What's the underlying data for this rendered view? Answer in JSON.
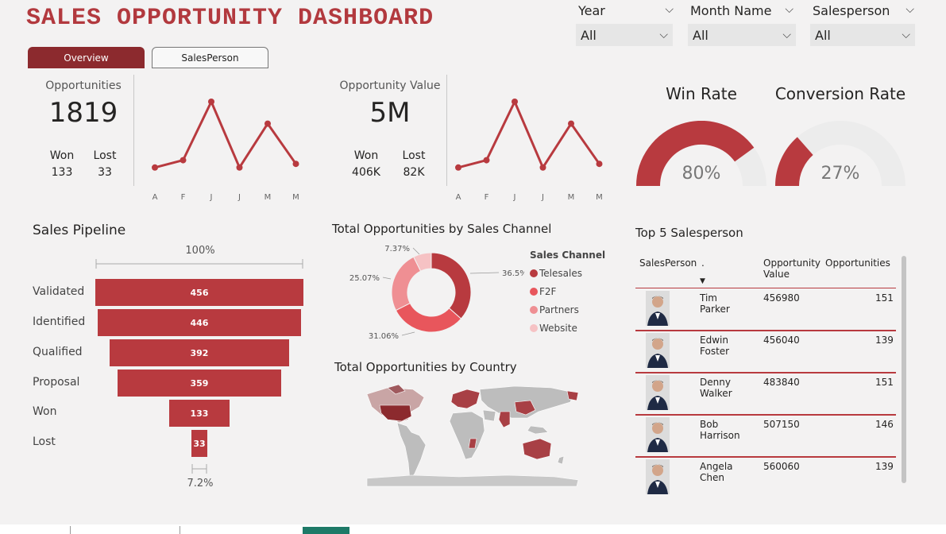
{
  "header": {
    "title": "SALES OPPORTUNITY DASHBOARD"
  },
  "filters": [
    {
      "label": "Year",
      "value": "All"
    },
    {
      "label": "Month Name",
      "value": "All"
    },
    {
      "label": "Salesperson",
      "value": "All"
    }
  ],
  "tabs": [
    {
      "label": "Overview",
      "active": true
    },
    {
      "label": "SalesPerson",
      "active": false
    }
  ],
  "kpis": {
    "opportunities": {
      "label": "Opportunities",
      "value": "1819",
      "won_label": "Won",
      "won_value": "133",
      "lost_label": "Lost",
      "lost_value": "33"
    },
    "opportunity_value": {
      "label": "Opportunity Value",
      "value": "5M",
      "won_label": "Won",
      "won_value": "406K",
      "lost_label": "Lost",
      "lost_value": "82K"
    }
  },
  "gauges": [
    {
      "title": "Win Rate",
      "value_text": "80%",
      "value": 0.8,
      "color": "#b83a3f"
    },
    {
      "title": "Conversion Rate",
      "value_text": "27%",
      "value": 0.27,
      "color": "#b83a3f"
    }
  ],
  "pipeline": {
    "title": "Sales Pipeline",
    "top_pct": "100%",
    "bottom_pct": "7.2%"
  },
  "sales_channel": {
    "title": "Total Opportunities by Sales Channel",
    "legend_title": "Sales Channel"
  },
  "country": {
    "title": "Total Opportunities by Country"
  },
  "top5": {
    "title": "Top 5 Salesperson",
    "headers": {
      "salesperson": "SalesPerson",
      "dot": ".",
      "opp_value": "Opportunity Value",
      "opportunities": "Opportunities"
    },
    "rows": [
      {
        "name": "Tim Parker",
        "value": "456980",
        "opps": "151"
      },
      {
        "name": "Edwin Foster",
        "value": "456040",
        "opps": "139"
      },
      {
        "name": "Denny Walker",
        "value": "483840",
        "opps": "151"
      },
      {
        "name": "Bob Harrison",
        "value": "507150",
        "opps": "146"
      },
      {
        "name": "Angela Chen",
        "value": "560060",
        "opps": "139"
      }
    ]
  },
  "chart_data": [
    {
      "type": "line",
      "categories": [
        "A",
        "F",
        "J",
        "J",
        "M",
        "M"
      ],
      "values": [
        12,
        14,
        30,
        12,
        24,
        13
      ],
      "color": "#b83a3f"
    },
    {
      "type": "line",
      "categories": [
        "A",
        "F",
        "J",
        "J",
        "M",
        "M"
      ],
      "values": [
        12,
        14,
        30,
        12,
        24,
        13
      ],
      "color": "#b83a3f"
    },
    {
      "type": "bar",
      "orientation": "funnel",
      "categories": [
        "Validated",
        "Identified",
        "Qualified",
        "Proposal",
        "Won",
        "Lost"
      ],
      "values": [
        456,
        446,
        392,
        359,
        133,
        33
      ],
      "color": "#b83a3f"
    },
    {
      "type": "pie",
      "donut": true,
      "categories": [
        "Telesales",
        "F2F",
        "Partners",
        "Website"
      ],
      "values": [
        36.5,
        31.06,
        25.07,
        7.37
      ],
      "labels": [
        "36.5%",
        "31.06%",
        "25.07%",
        "7.37%"
      ],
      "colors": [
        "#b83a3f",
        "#e8565c",
        "#ef8f93",
        "#f6c2c4"
      ]
    }
  ]
}
